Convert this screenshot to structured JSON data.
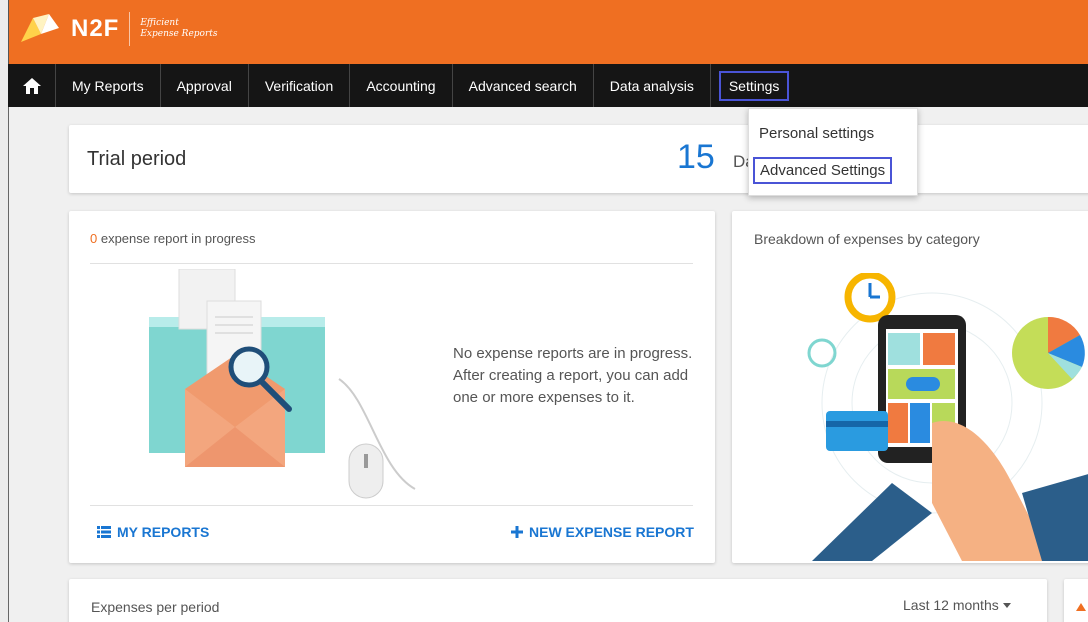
{
  "header": {
    "logo_text": "N2F",
    "tagline_line1": "Efficient",
    "tagline_line2": "Expense Reports",
    "brand_color": "#ef6f22"
  },
  "nav": {
    "home_icon": "home-icon",
    "items": [
      {
        "label": "My Reports"
      },
      {
        "label": "Approval"
      },
      {
        "label": "Verification"
      },
      {
        "label": "Accounting"
      },
      {
        "label": "Advanced search"
      },
      {
        "label": "Data analysis"
      },
      {
        "label": "Settings"
      }
    ]
  },
  "settings_menu": {
    "items": [
      {
        "label": "Personal settings"
      },
      {
        "label": "Advanced Settings"
      }
    ]
  },
  "trial": {
    "title": "Trial period",
    "days_value": "15",
    "days_label": "Da"
  },
  "reports_card": {
    "count": "0",
    "count_suffix": " expense report in progress",
    "empty_line1": "No expense reports are in progress.",
    "empty_line2": "After creating a report, you can add one or more expenses to it.",
    "my_reports_label": "MY REPORTS",
    "new_report_label": "NEW EXPENSE REPORT"
  },
  "breakdown_card": {
    "title": "Breakdown of expenses by category"
  },
  "period_card": {
    "title": "Expenses per period",
    "range": "Last 12 months"
  },
  "colors": {
    "accent_blue": "#1976d2",
    "nav_bg": "#151515",
    "highlight_border": "#4a54d6"
  }
}
